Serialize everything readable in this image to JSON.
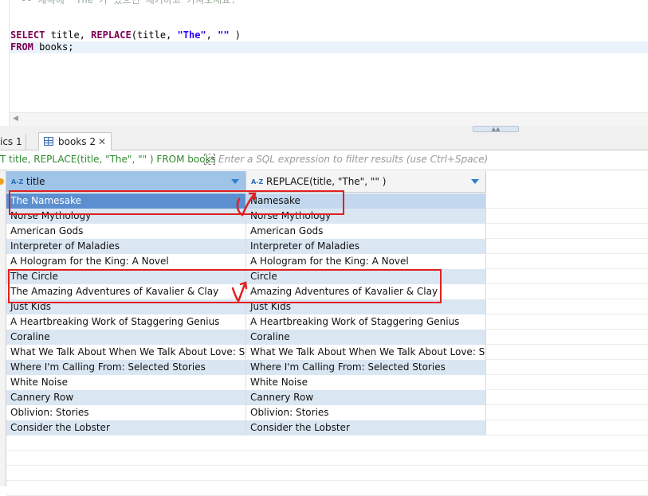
{
  "editor": {
    "comment": "-- 제목에 'The'가 있으면 제거하고 가져오세요.",
    "query_line1": {
      "kw_select": "SELECT",
      "part1": " title, ",
      "kw_replace": "REPLACE",
      "part2": "(title, ",
      "str_the": "\"The\"",
      "part3": ", ",
      "str_empty": "\"\"",
      "part4": " )"
    },
    "query_line2": {
      "kw_from": "FROM",
      "part1": " books;"
    }
  },
  "tabs": {
    "statistics_label": "ics 1",
    "active_label": "books 2",
    "close_glyph": "✕"
  },
  "filter": {
    "query_text": "T title, REPLACE(title, \"The\", \"\" ) FROM books",
    "placeholder": "Enter a SQL expression to filter results (use Ctrl+Space)",
    "expand_glyph": "⤢"
  },
  "grid": {
    "az_label": "A-Z",
    "columns": [
      "title",
      "REPLACE(title, \"The\", \"\" )"
    ],
    "rows": [
      [
        "The Namesake",
        " Namesake"
      ],
      [
        "Norse Mythology",
        "Norse Mythology"
      ],
      [
        "American Gods",
        "American Gods"
      ],
      [
        "Interpreter of Maladies",
        "Interpreter of Maladies"
      ],
      [
        "A Hologram for the King: A Novel",
        "A Hologram for the King: A Novel"
      ],
      [
        "The Circle",
        " Circle"
      ],
      [
        "The Amazing Adventures of Kavalier & Clay",
        " Amazing Adventures of Kavalier & Clay"
      ],
      [
        "Just Kids",
        "Just Kids"
      ],
      [
        "A Heartbreaking Work of Staggering Genius",
        "A Heartbreaking Work of Staggering Genius"
      ],
      [
        "Coraline",
        "Coraline"
      ],
      [
        "What We Talk About When We Talk About Love: Stories",
        "What We Talk About When We Talk About Love: Stories"
      ],
      [
        "Where I'm Calling From: Selected Stories",
        "Where I'm Calling From: Selected Stories"
      ],
      [
        "White Noise",
        "White Noise"
      ],
      [
        "Cannery Row",
        "Cannery Row"
      ],
      [
        "Oblivion: Stories",
        "Oblivion: Stories"
      ],
      [
        "Consider the Lobster",
        "Consider the Lobster"
      ]
    ]
  },
  "colors": {
    "keyword": "#7f0055",
    "string": "#2a00ff",
    "annotation_red": "#e02020",
    "selection": "#5b8fd0",
    "alt_row": "#dbe6f3"
  }
}
